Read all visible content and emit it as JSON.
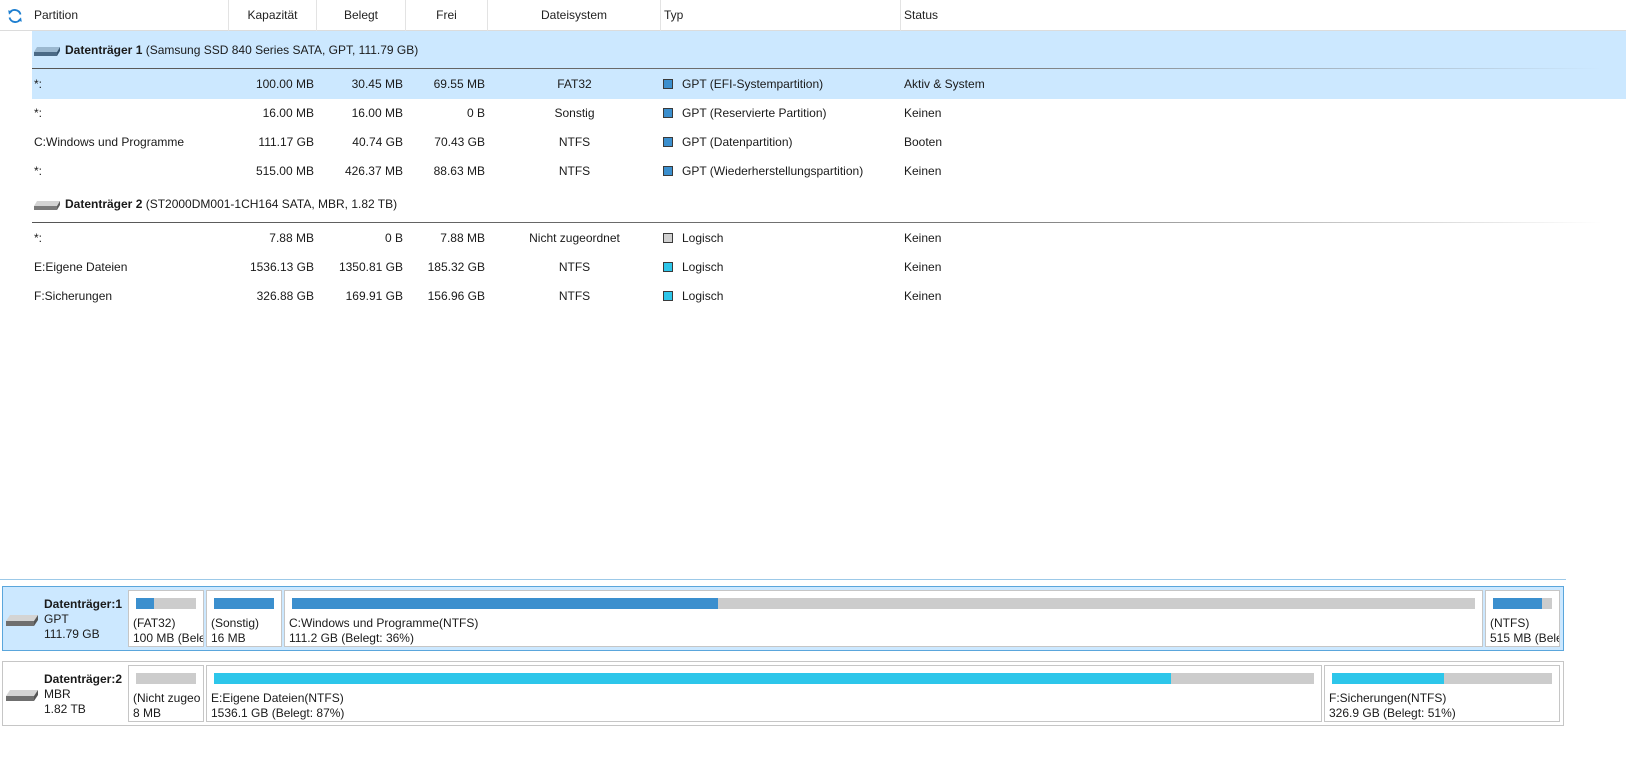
{
  "colors": {
    "accent": "#0078d7",
    "selected_bg": "#cce8ff",
    "used_blue": "#3b8fce",
    "used_cyan": "#2dc6ea",
    "unused": "#cccccc",
    "unallocated": "#d0d0d0"
  },
  "header": {
    "refresh_icon": "refresh-icon",
    "columns": [
      "Partition",
      "Kapazität",
      "Belegt",
      "Frei",
      "Dateisystem",
      "Typ",
      "Status"
    ]
  },
  "disks": [
    {
      "label_bold": "Datenträger 1",
      "label_rest": " (Samsung SSD 840 Series SATA, GPT, 111.79 GB)",
      "partitions": [
        {
          "name": "*:",
          "capacity": "100.00 MB",
          "used": "30.45 MB",
          "free": "69.55 MB",
          "fs": "FAT32",
          "type": "GPT (EFI-Systempartition)",
          "type_color": "#3b8fce",
          "status": "Aktiv & System"
        },
        {
          "name": "*:",
          "capacity": "16.00 MB",
          "used": "16.00 MB",
          "free": "0 B",
          "fs": "Sonstig",
          "type": "GPT (Reservierte Partition)",
          "type_color": "#3b8fce",
          "status": "Keinen"
        },
        {
          "name": "C:Windows und Programme",
          "capacity": "111.17 GB",
          "used": "40.74 GB",
          "free": "70.43 GB",
          "fs": "NTFS",
          "type": "GPT (Datenpartition)",
          "type_color": "#3b8fce",
          "status": "Booten"
        },
        {
          "name": "*:",
          "capacity": "515.00 MB",
          "used": "426.37 MB",
          "free": "88.63 MB",
          "fs": "NTFS",
          "type": "GPT (Wiederherstellungspartition)",
          "type_color": "#3b8fce",
          "status": "Keinen"
        }
      ]
    },
    {
      "label_bold": "Datenträger 2",
      "label_rest": " (ST2000DM001-1CH164 SATA, MBR, 1.82 TB)",
      "partitions": [
        {
          "name": "*:",
          "capacity": "7.88 MB",
          "used": "0 B",
          "free": "7.88 MB",
          "fs": "Nicht zugeordnet",
          "type": "Logisch",
          "type_color": "#d0d0d0",
          "status": "Keinen"
        },
        {
          "name": "E:Eigene Dateien",
          "capacity": "1536.13 GB",
          "used": "1350.81 GB",
          "free": "185.32 GB",
          "fs": "NTFS",
          "type": "Logisch",
          "type_color": "#2dc6ea",
          "status": "Keinen"
        },
        {
          "name": "F:Sicherungen",
          "capacity": "326.88 GB",
          "used": "169.91 GB",
          "free": "156.96 GB",
          "fs": "NTFS",
          "type": "Logisch",
          "type_color": "#2dc6ea",
          "status": "Keinen"
        }
      ]
    }
  ],
  "disk_map": [
    {
      "name": "Datenträger:1",
      "scheme": "GPT",
      "size": "111.79 GB",
      "blocks": [
        {
          "line1": "(FAT32)",
          "line2": "100 MB (Bele",
          "used_fraction": 0.3,
          "color": "#3b8fce"
        },
        {
          "line1": "(Sonstig)",
          "line2": "16 MB",
          "used_fraction": 1.0,
          "color": "#3b8fce"
        },
        {
          "line1": "C:Windows und Programme(NTFS)",
          "line2": "111.2 GB (Belegt: 36%)",
          "used_fraction": 0.36,
          "color": "#3b8fce"
        },
        {
          "line1": "(NTFS)",
          "line2": "515 MB (Bele",
          "used_fraction": 0.83,
          "color": "#3b8fce"
        }
      ]
    },
    {
      "name": "Datenträger:2",
      "scheme": "MBR",
      "size": "1.82 TB",
      "blocks": [
        {
          "line1": "(Nicht zugeo",
          "line2": "8 MB",
          "used_fraction": 0.0,
          "color": "#d0d0d0"
        },
        {
          "line1": "E:Eigene Dateien(NTFS)",
          "line2": "1536.1 GB (Belegt: 87%)",
          "used_fraction": 0.87,
          "color": "#2dc6ea"
        },
        {
          "line1": "F:Sicherungen(NTFS)",
          "line2": "326.9 GB (Belegt: 51%)",
          "used_fraction": 0.51,
          "color": "#2dc6ea"
        }
      ]
    }
  ]
}
